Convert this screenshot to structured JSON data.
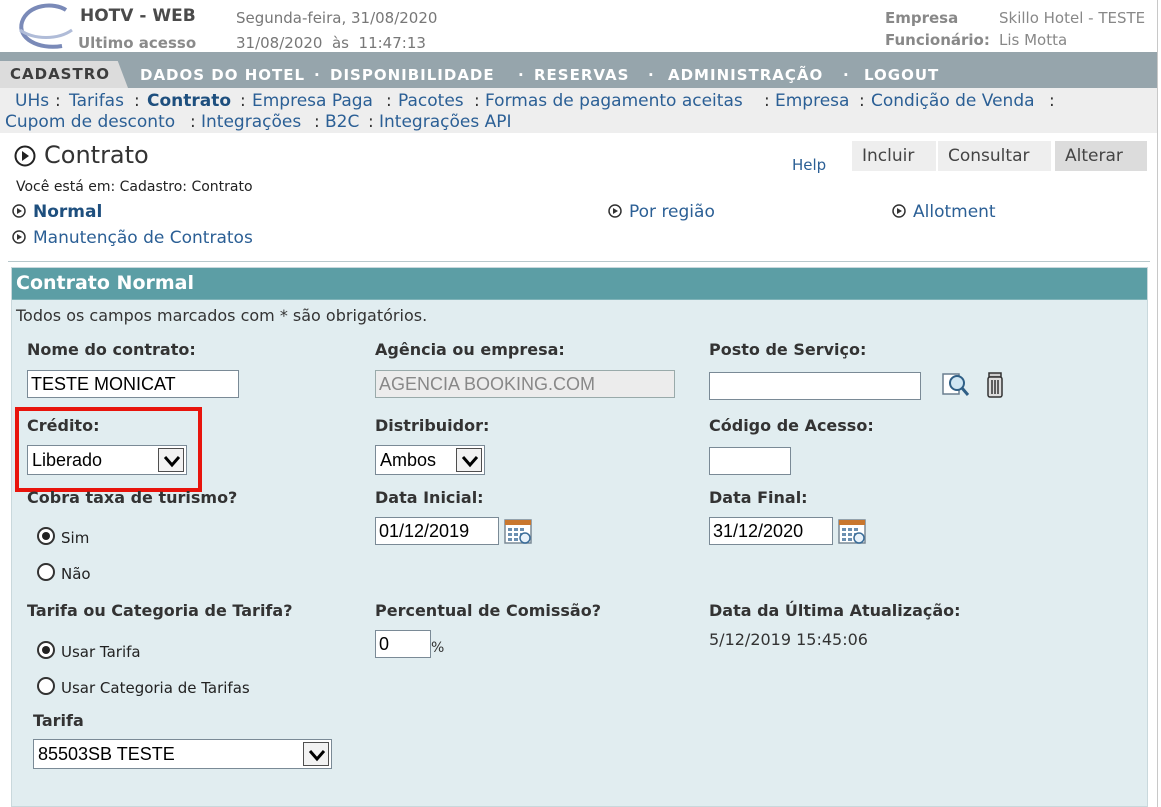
{
  "header": {
    "app_name": "HOTV - WEB",
    "last_access_label": "Ultimo acesso",
    "date_line": "Segunda-feira, 31/08/2020",
    "last_access": "31/08/2020  às  11:47:13",
    "company_label": "Empresa",
    "company": "Skillo Hotel - TESTE",
    "employee_label": "Funcionário:",
    "employee": "Lis Motta"
  },
  "nav": {
    "active": "CADASTRO",
    "items": [
      "DADOS DO HOTEL",
      "DISPONIBILIDADE",
      "RESERVAS",
      "ADMINISTRAÇÃO",
      "LOGOUT"
    ]
  },
  "submenu": {
    "items": [
      "UHs",
      "Tarifas",
      "Contrato",
      "Empresa Paga",
      "Pacotes",
      "Formas de pagamento aceitas",
      "Empresa",
      "Condição de Venda",
      "Cupom de desconto",
      "Integrações",
      "B2C",
      "Integrações API"
    ],
    "active": "Contrato"
  },
  "page": {
    "title": "Contrato",
    "help": "Help",
    "tabs": [
      "Incluir",
      "Consultar",
      "Alterar"
    ],
    "breadcrumb": "Você está em: Cadastro: Contrato",
    "options": [
      "Normal",
      "Por região",
      "Allotment",
      "Manutenção de Contratos"
    ]
  },
  "form": {
    "title": "Contrato Normal",
    "note": "Todos os campos marcados com * são obrigatórios.",
    "contract_name_label": "Nome do contrato:",
    "contract_name": "TESTE MONICAT",
    "agency_label": "Agência ou empresa:",
    "agency": "AGENCIA BOOKING.COM",
    "service_post_label": "Posto de Serviço:",
    "service_post": "",
    "credit_label": "Crédito:",
    "credit": "Liberado",
    "distributor_label": "Distribuidor:",
    "distributor": "Ambos",
    "access_code_label": "Código de Acesso:",
    "access_code": "",
    "tourism_tax_label": "Cobra taxa de turismo?",
    "tourism_yes": "Sim",
    "tourism_no": "Não",
    "start_date_label": "Data Inicial:",
    "start_date": "01/12/2019",
    "end_date_label": "Data Final:",
    "end_date": "31/12/2020",
    "rate_or_category_label": "Tarifa ou Categoria de Tarifa?",
    "use_rate": "Usar Tarifa",
    "use_category": "Usar Categoria de Tarifas",
    "commission_label": "Percentual de Comissão?",
    "commission": "0",
    "percent": "%",
    "last_update_label": "Data da Última Atualização:",
    "last_update": "5/12/2019 15:45:06",
    "rate_label": "Tarifa",
    "rate": "85503SB TESTE"
  },
  "colors": {
    "nav_bg": "#96a5ac",
    "panel_head": "#5c9ea5",
    "panel_bg": "#e1edf0",
    "link": "#2b5f95",
    "highlight": "#e8140c"
  }
}
